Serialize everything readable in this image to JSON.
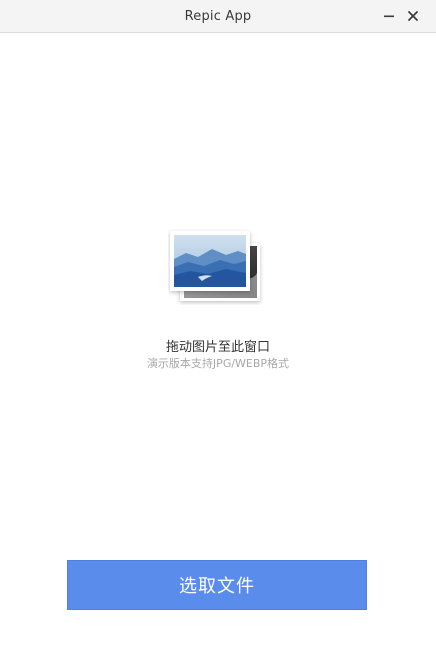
{
  "window": {
    "title": "Repic App",
    "minimize_symbol": "−",
    "close_symbol": "×"
  },
  "dropzone": {
    "icon": "photo-stack-icon",
    "title": "拖动图片至此窗口",
    "subtitle": "演示版本支持JPG/WEBP格式"
  },
  "actions": {
    "choose_file_label": "选取文件"
  },
  "colors": {
    "accent": "#5a8cec",
    "titlebar": "#f4f4f4",
    "subtitle": "#a8a8a8"
  }
}
